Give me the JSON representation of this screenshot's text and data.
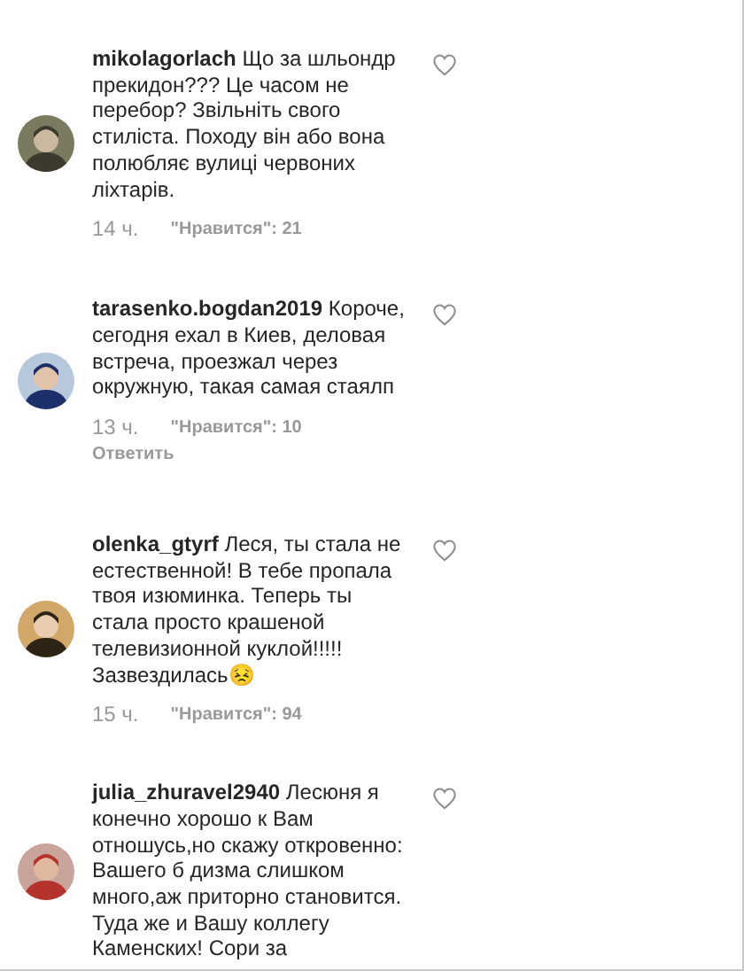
{
  "comments": [
    {
      "username": "mikolagorlach",
      "text": "Що за шльондр прекидон??? Це часом не перебор? Звільніть свого стиліста. Походу він або вона полюбляє вулиці червоних ліхтарів.",
      "time": "14 ч.",
      "likes": "\"Нравится\": 21"
    },
    {
      "username": "tarasenko.bogdan2019",
      "text": "Короче, сегодня ехал в Киев, деловая встреча, проезжал через окружную, такая самая стаялп",
      "time": "13 ч.",
      "likes": "\"Нравится\": 10",
      "reply": "Ответить"
    },
    {
      "username": "olenka_gtyrf",
      "text": "Леся, ты стала не естественной! В тебе пропала твоя изюминка. Теперь ты стала просто крашеной телевизионной куклой!!!!! Зазвездилась😣",
      "time": "15 ч.",
      "likes": "\"Нравится\": 94"
    },
    {
      "username": "julia_zhuravel2940",
      "text": "Лесюня я конечно хорошо к Вам отношусь,но скажу откровенно: Вашего б дизма слишком много,аж приторно становится. Туда же и Вашу коллегу Каменских! Сори за"
    }
  ]
}
